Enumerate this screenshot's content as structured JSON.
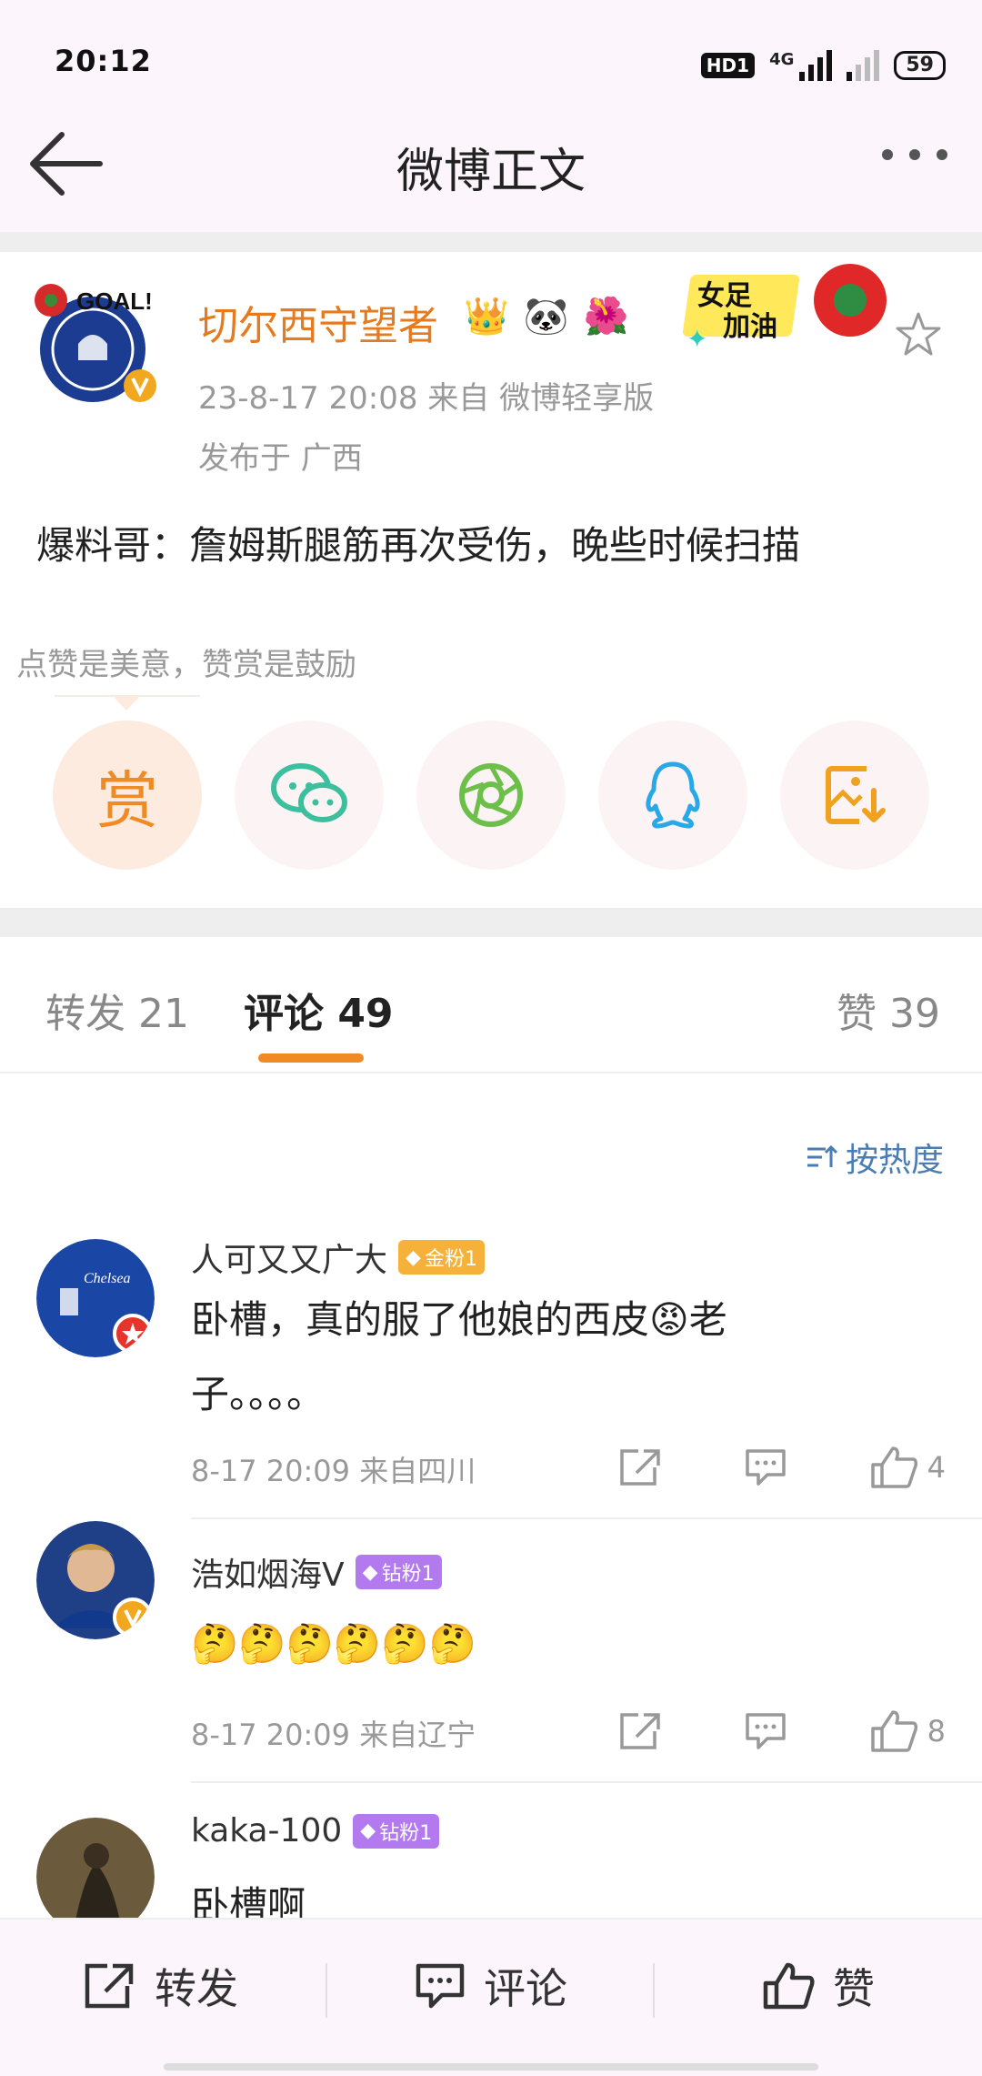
{
  "status": {
    "time": "20:12",
    "hd": "HD1",
    "net": "4G",
    "battery": "59"
  },
  "header": {
    "title": "微博正文"
  },
  "post": {
    "author": "切尔西守望者",
    "badges": [
      "👑",
      "🐼",
      "🌺"
    ],
    "deco_text_1": "女足",
    "deco_text_2": "加油",
    "meta": "23-8-17 20:08   来自 微博轻享版",
    "location": "发布于 广西",
    "content": "爆料哥：詹姆斯腿筋再次受伤，晚些时候扫描",
    "avatar_text": "GOAL!"
  },
  "reward": {
    "tip": "点赞是美意，赞赏是鼓励",
    "reward_label": "赏"
  },
  "tabs": {
    "repost": "转发 21",
    "comments": "评论 49",
    "likes": "赞 39"
  },
  "sort": {
    "label": "按热度"
  },
  "comments": [
    {
      "name": "人可又又广大",
      "badge": "金粉1",
      "line1": "卧槽，真的服了他娘的西皮😡老",
      "line2": "子。。。。",
      "meta": "8-17 20:09  来自四川",
      "likes": "4",
      "avatar_text": "Chelsea"
    },
    {
      "name": "浩如烟海V",
      "badge": "钻粉1",
      "line1": "🤔🤔🤔🤔🤔🤔",
      "meta": "8-17 20:09  来自辽宁",
      "likes": "8"
    },
    {
      "name": "kaka-100",
      "badge": "钻粉1",
      "line1": "卧槽啊"
    }
  ],
  "bottom": {
    "repost": "转发",
    "comment": "评论",
    "like": "赞"
  },
  "colors": {
    "accent": "#f08a24",
    "author": "#e67a1e",
    "link": "#4a7db4"
  }
}
